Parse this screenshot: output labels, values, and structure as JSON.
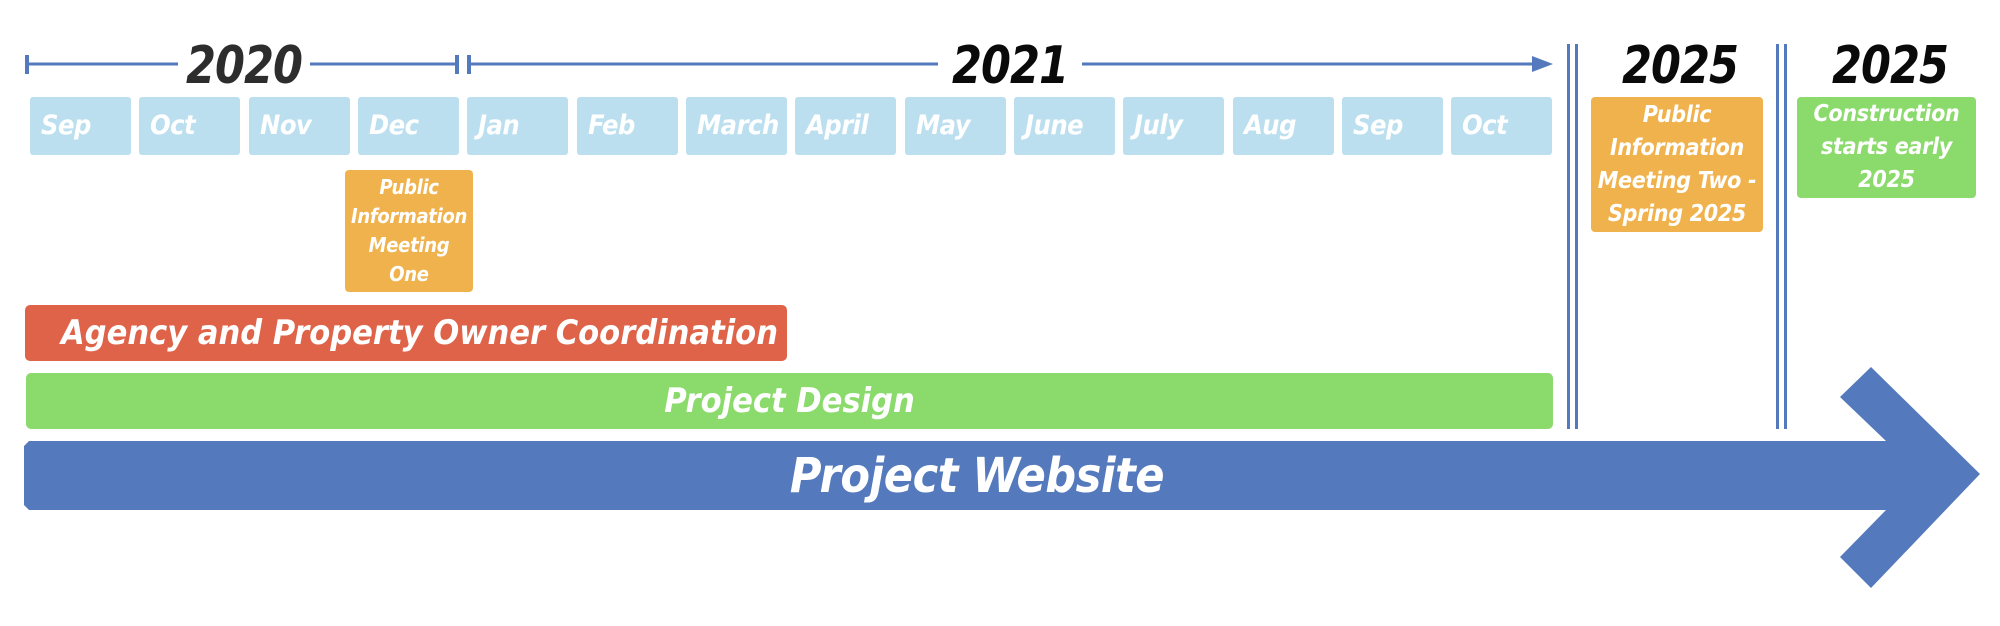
{
  "timeline": {
    "years": [
      {
        "label": "2020",
        "span_months": [
          "Sep",
          "Oct",
          "Nov",
          "Dec"
        ]
      },
      {
        "label": "2021",
        "span_months": [
          "Jan",
          "Feb",
          "March",
          "April",
          "May",
          "June",
          "July",
          "Aug",
          "Sep",
          "Oct"
        ]
      }
    ],
    "months": [
      "Sep",
      "Oct",
      "Nov",
      "Dec",
      "Jan",
      "Feb",
      "March",
      "April",
      "May",
      "June",
      "July",
      "Aug",
      "Sep",
      "Oct"
    ],
    "later_columns": [
      {
        "year": "2025",
        "milestone": "Public Information Meeting Two - Spring 2025",
        "milestone_lines": [
          "Public",
          "Information",
          "Meeting Two -",
          "Spring 2025"
        ]
      },
      {
        "year": "2025",
        "milestone": "Construction starts early 2025",
        "milestone_lines": [
          "Construction",
          "starts early",
          "2025"
        ]
      }
    ]
  },
  "milestones": {
    "meeting_one": {
      "lines": [
        "Public",
        "Information",
        "Meeting",
        "One"
      ],
      "month": "Dec 2020"
    }
  },
  "bars": {
    "coordination": {
      "label": "Agency and Property Owner Coordination",
      "start": "Sep 2020",
      "end": "March 2021"
    },
    "design": {
      "label": "Project Design",
      "start": "Sep 2020",
      "end": "Oct 2021"
    },
    "website": {
      "label": "Project Website",
      "start": "Sep 2020",
      "end": "ongoing"
    }
  },
  "colors": {
    "axis_blue": "#5479bc",
    "month_cell": "#bcdff0",
    "meeting_orange": "#f0b24d",
    "coordination_red": "#de6349",
    "design_green": "#8bda6c",
    "website_blue": "#5479bc"
  }
}
